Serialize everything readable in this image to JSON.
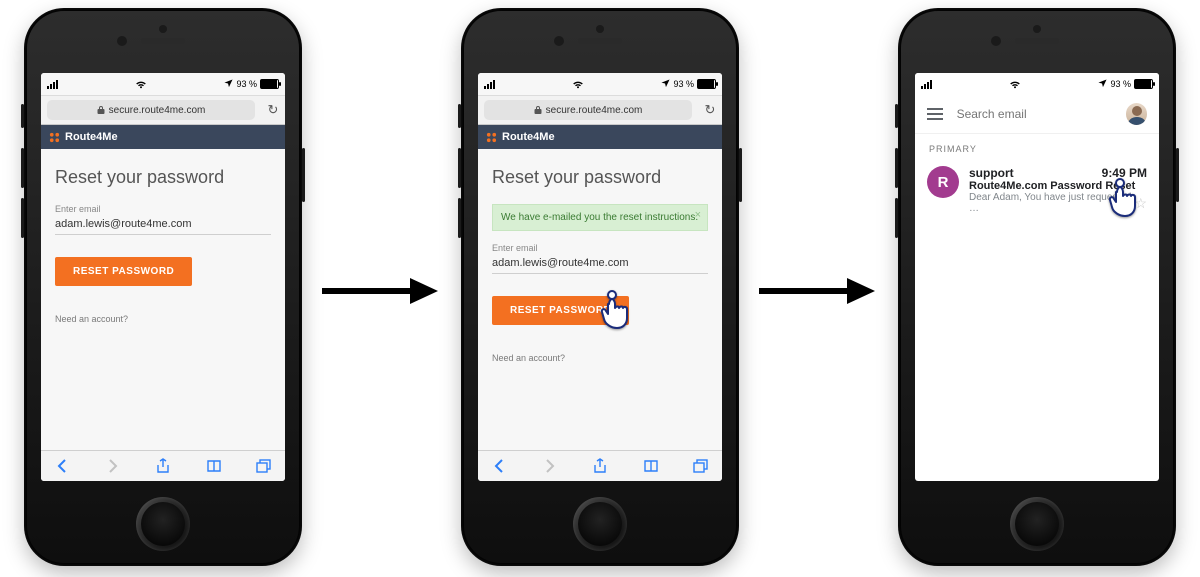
{
  "statusbar": {
    "battery": "93 %"
  },
  "addressbar": {
    "domain": "secure.route4me.com"
  },
  "brand": {
    "name": "Route4Me"
  },
  "screen1": {
    "title": "Reset your password",
    "email_label": "Enter email",
    "email_value": "adam.lewis@route4me.com",
    "button": "RESET PASSWORD",
    "need_account": "Need an account?"
  },
  "screen2": {
    "title": "Reset your password",
    "alert": "We have e-mailed you the reset instructions.",
    "email_label": "Enter email",
    "email_value": "adam.lewis@route4me.com",
    "button": "RESET PASSWORD",
    "need_account": "Need an account?"
  },
  "screen3": {
    "search_placeholder": "Search email",
    "section": "PRIMARY",
    "sender_initial": "R",
    "sender": "support",
    "time": "9:49 PM",
    "subject": "Route4Me.com Password Reset",
    "preview": "Dear Adam, You have just requested …"
  }
}
